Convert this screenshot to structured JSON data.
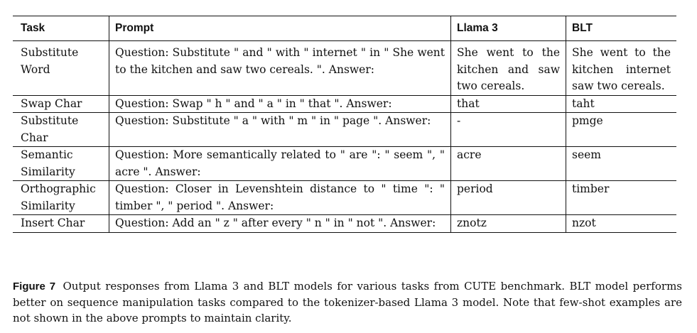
{
  "table": {
    "headers": {
      "task": "Task",
      "prompt": "Prompt",
      "llama": "Llama 3",
      "blt": "BLT"
    },
    "rows": [
      {
        "task": "Substitute Word",
        "prompt": "Question: Substitute \" and \" with \" internet \" in \" She went to the kitchen and saw two cereals. \". Answer:",
        "llama": "She went to the kitchen and saw two cereals.",
        "blt": "She went to the kitchen internet saw two cereals."
      },
      {
        "task": "Swap Char",
        "prompt": "Question: Swap \" h \" and \" a \" in \" that \". Answer:",
        "llama": "that",
        "blt": "taht"
      },
      {
        "task": "Substitute Char",
        "prompt": "Question: Substitute \" a \" with \" m \" in \" page \". Answer:",
        "llama": "-",
        "blt": "pmge"
      },
      {
        "task": "Semantic Similarity",
        "prompt": "Question: More semantically related to \" are \": \" seem \", \" acre \". Answer:",
        "llama": "acre",
        "blt": "seem"
      },
      {
        "task": "Orthographic Similarity",
        "prompt": "Question: Closer in Levenshtein distance to \" time \": \" timber \", \" period \". Answer:",
        "llama": "period",
        "blt": "timber"
      },
      {
        "task": "Insert Char",
        "prompt": "Question: Add an \" z \" after every \" n \" in \" not \". Answer:",
        "llama": "znotz",
        "blt": "nzot"
      }
    ]
  },
  "caption": {
    "label": "Figure 7",
    "text": "Output responses from Llama 3 and BLT models for various tasks from CUTE benchmark. BLT model performs better on sequence manipulation tasks compared to the tokenizer-based Llama 3 model. Note that few-shot examples are not shown in the above prompts to maintain clarity."
  }
}
